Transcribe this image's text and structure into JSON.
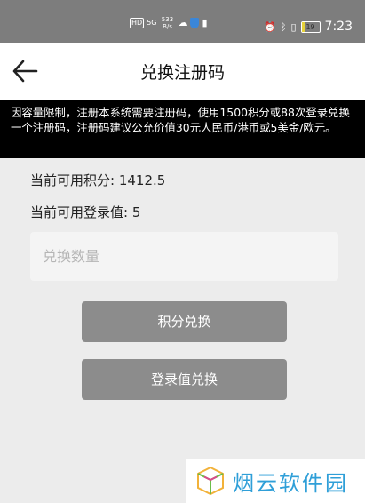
{
  "status_bar": {
    "hd": "HD",
    "signal": "5G",
    "speed_value": "533",
    "speed_unit": "B/s",
    "battery": "19",
    "time": "7:23"
  },
  "header": {
    "title": "兑换注册码",
    "back_icon": "back-arrow-icon"
  },
  "notice": {
    "text": "因容量限制，注册本系统需要注册码，使用1500积分或88次登录兑换一个注册码，注册码建议公允价值30元人民币/港币或5美金/欧元。"
  },
  "info": {
    "points_label": "当前可用积分: 1412.5",
    "logins_label": "当前可用登录值: 5"
  },
  "form": {
    "quantity_placeholder": "兑换数量",
    "quantity_value": ""
  },
  "buttons": {
    "points_exchange": "积分兑换",
    "login_exchange": "登录值兑换"
  },
  "watermark": {
    "text": "烟云软件园"
  },
  "colors": {
    "status_bar": "#7d7d7d",
    "notice_bg": "#000000",
    "button_bg": "#8c8c8c",
    "page_bg": "#ececec",
    "watermark_text": "#2f9fd8"
  }
}
